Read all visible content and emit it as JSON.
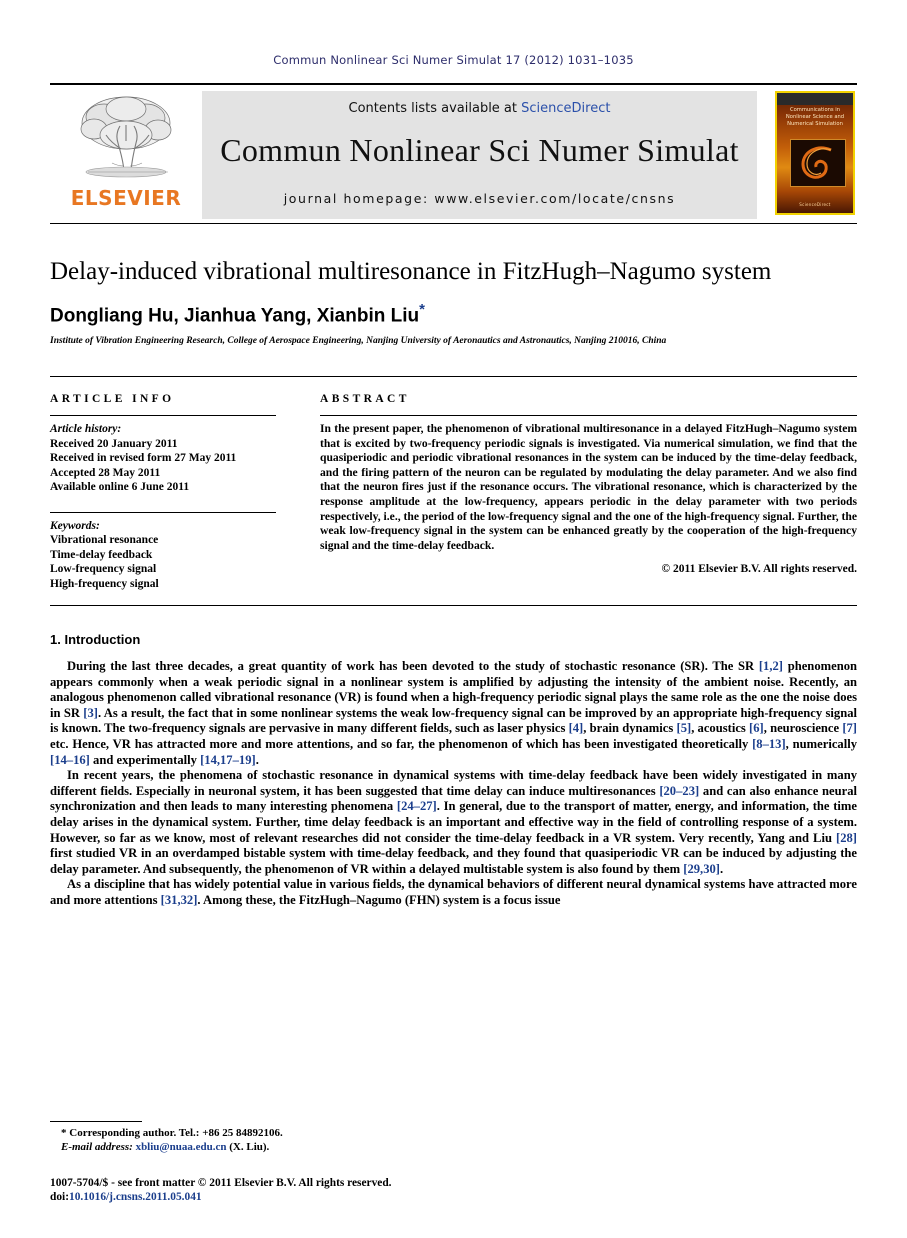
{
  "running_head": "Commun Nonlinear Sci Numer Simulat 17 (2012) 1031–1035",
  "masthead": {
    "contents_prefix": "Contents lists available at ",
    "sciencedirect": "ScienceDirect",
    "journal_title": "Commun Nonlinear Sci Numer Simulat",
    "homepage": "journal homepage: www.elsevier.com/locate/cnsns",
    "publisher_wordmark": "ELSEVIER",
    "cover": {
      "line1": "Communications in",
      "line2": "Nonlinear Science and",
      "line3": "Numerical Simulation",
      "footer": "ScienceDirect"
    },
    "link_color": "#2b50aa",
    "brand_orange": "#E87722"
  },
  "article": {
    "title": "Delay-induced vibrational multiresonance in FitzHugh–Nagumo system",
    "authors": "Dongliang Hu, Jianhua Yang, Xianbin Liu",
    "corresponding_marker": "*",
    "affiliation": "Institute of Vibration Engineering Research, College of Aerospace Engineering, Nanjing University of Aeronautics and Astronautics, Nanjing 210016, China"
  },
  "article_info": {
    "heading": "ARTICLE INFO",
    "history_label": "Article history:",
    "history": [
      "Received 20 January 2011",
      "Received in revised form 27 May 2011",
      "Accepted 28 May 2011",
      "Available online 6 June 2011"
    ],
    "keywords_label": "Keywords:",
    "keywords": [
      "Vibrational resonance",
      "Time-delay feedback",
      "Low-frequency signal",
      "High-frequency signal"
    ]
  },
  "abstract": {
    "heading": "ABSTRACT",
    "text": "In the present paper, the phenomenon of vibrational multiresonance in a delayed FitzHugh–Nagumo system that is excited by two-frequency periodic signals is investigated. Via numerical simulation, we find that the quasiperiodic and periodic vibrational resonances in the system can be induced by the time-delay feedback, and the firing pattern of the neuron can be regulated by modulating the delay parameter. And we also find that the neuron fires just if the resonance occurs. The vibrational resonance, which is characterized by the response amplitude at the low-frequency, appears periodic in the delay parameter with two periods respectively, i.e., the period of the low-frequency signal and the one of the high-frequency signal. Further, the weak low-frequency signal in the system can be enhanced greatly by the cooperation of the high-frequency signal and the time-delay feedback.",
    "copyright": "© 2011 Elsevier B.V. All rights reserved."
  },
  "introduction": {
    "heading": "1. Introduction",
    "paragraphs": [
      [
        {
          "t": "During the last three decades, a great quantity of work has been devoted to the study of stochastic resonance (SR). The SR "
        },
        {
          "t": "[1,2]",
          "c": true
        },
        {
          "t": " phenomenon appears commonly when a weak periodic signal in a nonlinear system is amplified by adjusting the intensity of the ambient noise. Recently, an analogous phenomenon called vibrational resonance (VR) is found when a high-frequency periodic signal plays the same role as the one the noise does in SR "
        },
        {
          "t": "[3]",
          "c": true
        },
        {
          "t": ". As a result, the fact that in some nonlinear systems the weak low-frequency signal can be improved by an appropriate high-frequency signal is known. The two-frequency signals are pervasive in many different fields, such as laser physics "
        },
        {
          "t": "[4]",
          "c": true
        },
        {
          "t": ", brain dynamics "
        },
        {
          "t": "[5]",
          "c": true
        },
        {
          "t": ", acoustics "
        },
        {
          "t": "[6]",
          "c": true
        },
        {
          "t": ", neuroscience "
        },
        {
          "t": "[7]",
          "c": true
        },
        {
          "t": " etc. Hence, VR has attracted more and more attentions, and so far, the phenomenon of which has been investigated theoretically "
        },
        {
          "t": "[8–13]",
          "c": true
        },
        {
          "t": ", numerically "
        },
        {
          "t": "[14–16]",
          "c": true
        },
        {
          "t": " and experimentally "
        },
        {
          "t": "[14,17–19]",
          "c": true
        },
        {
          "t": "."
        }
      ],
      [
        {
          "t": "In recent years, the phenomena of stochastic resonance in dynamical systems with time-delay feedback have been widely investigated in many different fields. Especially in neuronal system, it has been suggested that time delay can induce multiresonances "
        },
        {
          "t": "[20–23]",
          "c": true
        },
        {
          "t": " and can also enhance neural synchronization and then leads to many interesting phenomena "
        },
        {
          "t": "[24–27]",
          "c": true
        },
        {
          "t": ". In general, due to the transport of matter, energy, and information, the time delay arises in the dynamical system. Further, time delay feedback is an important and effective way in the field of controlling response of a system. However, so far as we know, most of relevant researches did not consider the time-delay feedback in a VR system. Very recently, Yang and Liu "
        },
        {
          "t": "[28]",
          "c": true
        },
        {
          "t": " first studied VR in an overdamped bistable system with time-delay feedback, and they found that quasiperiodic VR can be induced by adjusting the delay parameter. And subsequently, the phenomenon of VR within a delayed multistable system is also found by them "
        },
        {
          "t": "[29,30]",
          "c": true
        },
        {
          "t": "."
        }
      ],
      [
        {
          "t": "As a discipline that has widely potential value in various fields, the dynamical behaviors of different neural dynamical systems have attracted more and more attentions "
        },
        {
          "t": "[31,32]",
          "c": true
        },
        {
          "t": ". Among these, the FitzHugh–Nagumo (FHN) system is a focus issue"
        }
      ]
    ]
  },
  "footnotes": {
    "corresponding": "* Corresponding author. Tel.: +86 25 84892106.",
    "email_label": "E-mail address:",
    "email": "xbliu@nuaa.edu.cn",
    "email_suffix": "(X. Liu)."
  },
  "imprint": {
    "line1": "1007-5704/$ - see front matter © 2011 Elsevier B.V. All rights reserved.",
    "doi_label": "doi:",
    "doi": "10.1016/j.cnsns.2011.05.041"
  }
}
